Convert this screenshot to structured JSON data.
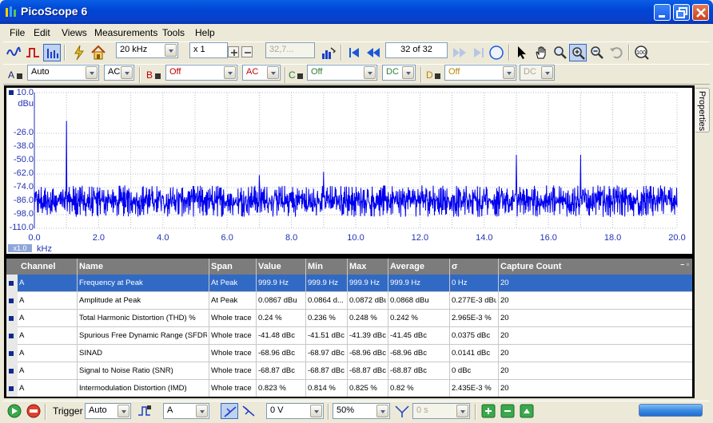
{
  "window": {
    "title": "PicoScope 6"
  },
  "menu": [
    "File",
    "Edit",
    "Views",
    "Measurements",
    "Tools",
    "Help"
  ],
  "toolbar": {
    "timebase": "20 kHz",
    "zoom_factor": "x 1",
    "sample_count": "32,7...",
    "buffer_position": "32 of 32"
  },
  "channels": [
    {
      "label": "A",
      "range": "Auto",
      "coupling": "AC",
      "color": "#1a237e"
    },
    {
      "label": "B",
      "range": "Off",
      "coupling": "AC",
      "color": "#c00000"
    },
    {
      "label": "C",
      "range": "Off",
      "coupling": "DC",
      "color": "#2e7d32"
    },
    {
      "label": "D",
      "range": "Off",
      "coupling": "DC",
      "color": "#b8860b"
    }
  ],
  "scope": {
    "y_top": "10.0",
    "y_unit": "dBu",
    "x_unit": "kHz",
    "zoom_badge": "x1.0",
    "y_ticks": [
      "-26.0",
      "-38.0",
      "-50.0",
      "-62.0",
      "-74.0",
      "-86.0",
      "-98.0",
      "-110.0"
    ],
    "x_ticks": [
      "0.0",
      "2.0",
      "4.0",
      "6.0",
      "8.0",
      "10.0",
      "12.0",
      "14.0",
      "16.0",
      "18.0",
      "20.0"
    ],
    "trace_color": "#0000ee"
  },
  "chart_data": {
    "type": "line",
    "xlabel": "kHz",
    "ylabel": "dBu",
    "xlim": [
      0,
      20
    ],
    "ylim": [
      -110,
      10
    ],
    "noise_floor_range": [
      -100,
      -72
    ],
    "peaks": [
      {
        "x": 1.0,
        "y": -15
      },
      {
        "x": 7.0,
        "y": -63
      },
      {
        "x": 9.0,
        "y": -60
      },
      {
        "x": 15.0,
        "y": -45
      },
      {
        "x": 17.0,
        "y": -45
      }
    ]
  },
  "measurements": {
    "headers": [
      "Channel",
      "Name",
      "Span",
      "Value",
      "Min",
      "Max",
      "Average",
      "σ",
      "Capture Count"
    ],
    "rows": [
      [
        "A",
        "Frequency at Peak",
        "At Peak",
        "999.9 Hz",
        "999.9 Hz",
        "999.9 Hz",
        "999.9 Hz",
        "0 Hz",
        "20"
      ],
      [
        "A",
        "Amplitude at Peak",
        "At Peak",
        "0.0867 dBu",
        "0.0864 d...",
        "0.0872 dBu",
        "0.0868 dBu",
        "0.277E-3 dBu",
        "20"
      ],
      [
        "A",
        "Total Harmonic Distortion (THD) %",
        "Whole trace",
        "0.24 %",
        "0.236 %",
        "0.248 %",
        "0.242 %",
        "2.965E-3 %",
        "20"
      ],
      [
        "A",
        "Spurious Free Dynamic Range (SFDR)",
        "Whole trace",
        "-41.48 dBc",
        "-41.51 dBc",
        "-41.39 dBc",
        "-41.45 dBc",
        "0.0375 dBc",
        "20"
      ],
      [
        "A",
        "SINAD",
        "Whole trace",
        "-68.96 dBc",
        "-68.97 dBc",
        "-68.96 dBc",
        "-68.96 dBc",
        "0.0141 dBc",
        "20"
      ],
      [
        "A",
        "Signal to Noise Ratio (SNR)",
        "Whole trace",
        "-68.87 dBc",
        "-68.87 dBc",
        "-68.87 dBc",
        "-68.87 dBc",
        "0 dBc",
        "20"
      ],
      [
        "A",
        "Intermodulation Distortion (IMD)",
        "Whole trace",
        "0.823 %",
        "0.814 %",
        "0.825 %",
        "0.82 %",
        "2.435E-3 %",
        "20"
      ]
    ]
  },
  "statusbar": {
    "trigger_label": "Trigger",
    "trigger_mode": "Auto",
    "trigger_source": "A",
    "threshold": "0 V",
    "pre_trigger": "50%",
    "delay": "0 s"
  },
  "properties_tab": "Properties"
}
